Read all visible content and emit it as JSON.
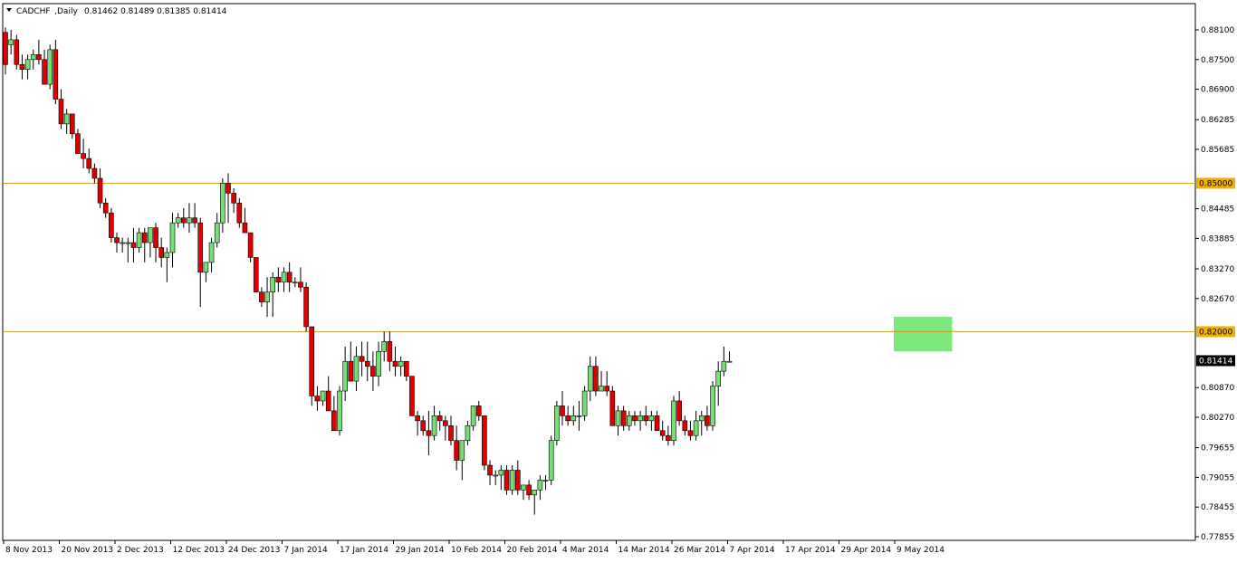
{
  "header": {
    "symbol": "CADCHF",
    "timeframe": "Daily",
    "ohlc": "0.81462 0.81489 0.81385 0.81414"
  },
  "colors": {
    "background": "#ffffff",
    "bull": "#77dd77",
    "bear": "#dd0000",
    "wick": "#000000",
    "level_line": "#c8a02a",
    "level_label_bg": "#f0b000",
    "zone": "#7de87d",
    "price_label_bg": "#000000"
  },
  "chart_data": {
    "type": "candlestick",
    "symbol": "CADCHF",
    "timeframe": "Daily",
    "ylim": [
      0.7775,
      0.8825
    ],
    "y_ticks": [
      "0.88100",
      "0.87500",
      "0.86900",
      "0.86285",
      "0.85685",
      "0.85000",
      "0.84485",
      "0.83885",
      "0.83270",
      "0.82670",
      "0.82000",
      "0.81414",
      "0.80870",
      "0.80270",
      "0.79655",
      "0.79055",
      "0.78455",
      "0.77855"
    ],
    "x_labels": [
      {
        "label": "8 Nov 2013",
        "index": 0
      },
      {
        "label": "20 Nov 2013",
        "index": 10
      },
      {
        "label": "2 Dec 2013",
        "index": 20
      },
      {
        "label": "12 Dec 2013",
        "index": 30
      },
      {
        "label": "24 Dec 2013",
        "index": 40
      },
      {
        "label": "7 Jan 2014",
        "index": 50
      },
      {
        "label": "17 Jan 2014",
        "index": 60
      },
      {
        "label": "29 Jan 2014",
        "index": 70
      },
      {
        "label": "10 Feb 2014",
        "index": 80
      },
      {
        "label": "20 Feb 2014",
        "index": 90
      },
      {
        "label": "4 Mar 2014",
        "index": 100
      },
      {
        "label": "14 Mar 2014",
        "index": 110
      },
      {
        "label": "26 Mar 2014",
        "index": 120
      },
      {
        "label": "7 Apr 2014",
        "index": 130
      },
      {
        "label": "17 Apr 2014",
        "index": 140
      },
      {
        "label": "29 Apr 2014",
        "index": 150
      },
      {
        "label": "9 May 2014",
        "index": 160
      }
    ],
    "candles": [
      [
        0.8805,
        0.8815,
        0.872,
        0.874
      ],
      [
        0.878,
        0.881,
        0.876,
        0.879
      ],
      [
        0.879,
        0.88,
        0.873,
        0.874
      ],
      [
        0.874,
        0.876,
        0.871,
        0.873
      ],
      [
        0.873,
        0.876,
        0.871,
        0.875
      ],
      [
        0.875,
        0.877,
        0.873,
        0.876
      ],
      [
        0.876,
        0.879,
        0.874,
        0.875
      ],
      [
        0.875,
        0.877,
        0.87,
        0.87
      ],
      [
        0.87,
        0.878,
        0.869,
        0.877
      ],
      [
        0.877,
        0.879,
        0.866,
        0.867
      ],
      [
        0.867,
        0.869,
        0.861,
        0.862
      ],
      [
        0.862,
        0.865,
        0.86,
        0.864
      ],
      [
        0.864,
        0.864,
        0.859,
        0.86
      ],
      [
        0.86,
        0.861,
        0.856,
        0.856
      ],
      [
        0.856,
        0.859,
        0.853,
        0.855
      ],
      [
        0.855,
        0.857,
        0.852,
        0.853
      ],
      [
        0.853,
        0.854,
        0.85,
        0.851
      ],
      [
        0.851,
        0.853,
        0.845,
        0.846
      ],
      [
        0.846,
        0.847,
        0.843,
        0.844
      ],
      [
        0.844,
        0.845,
        0.838,
        0.839
      ],
      [
        0.839,
        0.84,
        0.836,
        0.838
      ],
      [
        0.838,
        0.839,
        0.836,
        0.838
      ],
      [
        0.838,
        0.839,
        0.834,
        0.838
      ],
      [
        0.838,
        0.841,
        0.834,
        0.837
      ],
      [
        0.837,
        0.841,
        0.836,
        0.84
      ],
      [
        0.84,
        0.841,
        0.834,
        0.838
      ],
      [
        0.838,
        0.841,
        0.835,
        0.841
      ],
      [
        0.841,
        0.842,
        0.834,
        0.837
      ],
      [
        0.837,
        0.839,
        0.833,
        0.835
      ],
      [
        0.835,
        0.837,
        0.83,
        0.836
      ],
      [
        0.836,
        0.844,
        0.833,
        0.842
      ],
      [
        0.842,
        0.844,
        0.841,
        0.843
      ],
      [
        0.843,
        0.845,
        0.841,
        0.842
      ],
      [
        0.842,
        0.846,
        0.84,
        0.843
      ],
      [
        0.843,
        0.846,
        0.841,
        0.842
      ],
      [
        0.842,
        0.843,
        0.825,
        0.832
      ],
      [
        0.832,
        0.834,
        0.83,
        0.834
      ],
      [
        0.834,
        0.839,
        0.832,
        0.838
      ],
      [
        0.838,
        0.844,
        0.837,
        0.842
      ],
      [
        0.842,
        0.851,
        0.84,
        0.85
      ],
      [
        0.85,
        0.852,
        0.842,
        0.848
      ],
      [
        0.848,
        0.849,
        0.844,
        0.846
      ],
      [
        0.846,
        0.847,
        0.841,
        0.842
      ],
      [
        0.842,
        0.845,
        0.84,
        0.84
      ],
      [
        0.84,
        0.84,
        0.834,
        0.835
      ],
      [
        0.835,
        0.835,
        0.828,
        0.828
      ],
      [
        0.828,
        0.829,
        0.825,
        0.826
      ],
      [
        0.826,
        0.831,
        0.823,
        0.828
      ],
      [
        0.828,
        0.832,
        0.823,
        0.831
      ],
      [
        0.831,
        0.833,
        0.828,
        0.83
      ],
      [
        0.83,
        0.833,
        0.828,
        0.832
      ],
      [
        0.832,
        0.834,
        0.828,
        0.83
      ],
      [
        0.83,
        0.831,
        0.829,
        0.83
      ],
      [
        0.83,
        0.833,
        0.828,
        0.829
      ],
      [
        0.829,
        0.83,
        0.82,
        0.821
      ],
      [
        0.821,
        0.821,
        0.805,
        0.807
      ],
      [
        0.807,
        0.809,
        0.804,
        0.806
      ],
      [
        0.806,
        0.808,
        0.805,
        0.808
      ],
      [
        0.808,
        0.811,
        0.805,
        0.804
      ],
      [
        0.804,
        0.807,
        0.801,
        0.8
      ],
      [
        0.8,
        0.809,
        0.799,
        0.808
      ],
      [
        0.808,
        0.817,
        0.806,
        0.814
      ],
      [
        0.814,
        0.818,
        0.81,
        0.81
      ],
      [
        0.81,
        0.817,
        0.808,
        0.815
      ],
      [
        0.815,
        0.818,
        0.811,
        0.814
      ],
      [
        0.814,
        0.818,
        0.81,
        0.813
      ],
      [
        0.813,
        0.816,
        0.808,
        0.811
      ],
      [
        0.811,
        0.818,
        0.809,
        0.816
      ],
      [
        0.816,
        0.82,
        0.814,
        0.818
      ],
      [
        0.818,
        0.82,
        0.812,
        0.814
      ],
      [
        0.814,
        0.817,
        0.811,
        0.813
      ],
      [
        0.813,
        0.815,
        0.811,
        0.814
      ],
      [
        0.814,
        0.814,
        0.81,
        0.811
      ],
      [
        0.811,
        0.811,
        0.803,
        0.803
      ],
      [
        0.803,
        0.804,
        0.799,
        0.802
      ],
      [
        0.802,
        0.803,
        0.799,
        0.8
      ],
      [
        0.8,
        0.804,
        0.795,
        0.799
      ],
      [
        0.799,
        0.805,
        0.798,
        0.803
      ],
      [
        0.803,
        0.804,
        0.8,
        0.802
      ],
      [
        0.802,
        0.803,
        0.798,
        0.801
      ],
      [
        0.801,
        0.803,
        0.797,
        0.798
      ],
      [
        0.798,
        0.801,
        0.792,
        0.794
      ],
      [
        0.794,
        0.796,
        0.79,
        0.798
      ],
      [
        0.798,
        0.802,
        0.797,
        0.801
      ],
      [
        0.801,
        0.805,
        0.8,
        0.805
      ],
      [
        0.805,
        0.806,
        0.802,
        0.803
      ],
      [
        0.803,
        0.803,
        0.792,
        0.793
      ],
      [
        0.793,
        0.794,
        0.789,
        0.791
      ],
      [
        0.791,
        0.792,
        0.789,
        0.791
      ],
      [
        0.791,
        0.793,
        0.788,
        0.792
      ],
      [
        0.792,
        0.793,
        0.787,
        0.788
      ],
      [
        0.788,
        0.793,
        0.787,
        0.792
      ],
      [
        0.792,
        0.794,
        0.787,
        0.788
      ],
      [
        0.788,
        0.789,
        0.786,
        0.789
      ],
      [
        0.789,
        0.79,
        0.786,
        0.787
      ],
      [
        0.787,
        0.788,
        0.783,
        0.788
      ],
      [
        0.788,
        0.791,
        0.786,
        0.79
      ],
      [
        0.79,
        0.791,
        0.788,
        0.79
      ],
      [
        0.79,
        0.799,
        0.789,
        0.798
      ],
      [
        0.798,
        0.806,
        0.797,
        0.805
      ],
      [
        0.805,
        0.808,
        0.801,
        0.803
      ],
      [
        0.803,
        0.805,
        0.801,
        0.802
      ],
      [
        0.802,
        0.805,
        0.801,
        0.803
      ],
      [
        0.803,
        0.806,
        0.8,
        0.803
      ],
      [
        0.803,
        0.809,
        0.802,
        0.808
      ],
      [
        0.808,
        0.815,
        0.806,
        0.813
      ],
      [
        0.813,
        0.815,
        0.807,
        0.808
      ],
      [
        0.808,
        0.812,
        0.808,
        0.809
      ],
      [
        0.809,
        0.812,
        0.807,
        0.808
      ],
      [
        0.808,
        0.809,
        0.801,
        0.801
      ],
      [
        0.801,
        0.805,
        0.799,
        0.804
      ],
      [
        0.804,
        0.805,
        0.8,
        0.801
      ],
      [
        0.801,
        0.804,
        0.8,
        0.803
      ],
      [
        0.803,
        0.804,
        0.801,
        0.802
      ],
      [
        0.802,
        0.804,
        0.8,
        0.803
      ],
      [
        0.803,
        0.805,
        0.801,
        0.802
      ],
      [
        0.802,
        0.804,
        0.8,
        0.803
      ],
      [
        0.803,
        0.804,
        0.8,
        0.8
      ],
      [
        0.8,
        0.802,
        0.798,
        0.799
      ],
      [
        0.799,
        0.801,
        0.797,
        0.798
      ],
      [
        0.798,
        0.807,
        0.797,
        0.806
      ],
      [
        0.806,
        0.808,
        0.801,
        0.802
      ],
      [
        0.802,
        0.803,
        0.799,
        0.8
      ],
      [
        0.8,
        0.802,
        0.798,
        0.799
      ],
      [
        0.799,
        0.804,
        0.798,
        0.802
      ],
      [
        0.802,
        0.804,
        0.799,
        0.803
      ],
      [
        0.803,
        0.805,
        0.8,
        0.801
      ],
      [
        0.801,
        0.81,
        0.8,
        0.809
      ],
      [
        0.809,
        0.814,
        0.805,
        0.812
      ],
      [
        0.812,
        0.817,
        0.811,
        0.814
      ],
      [
        0.814,
        0.816,
        0.814,
        0.814
      ]
    ],
    "levels": [
      {
        "value": 0.85,
        "label": "0.85000"
      },
      {
        "value": 0.82,
        "label": "0.82000"
      }
    ],
    "zone": {
      "from_index": 160,
      "to_index": 170,
      "top": 0.823,
      "bottom": 0.816
    },
    "current_price": {
      "value": 0.81414,
      "label": "0.81414"
    }
  }
}
